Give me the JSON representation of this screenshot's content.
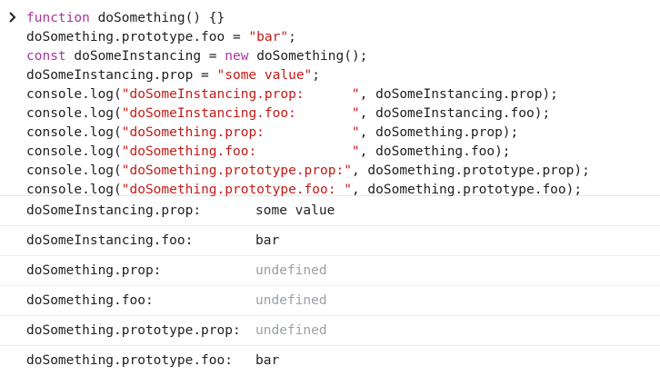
{
  "input": {
    "lines": [
      [
        {
          "t": "function",
          "c": "kw"
        },
        {
          "t": " doSomething() {}",
          "c": "fn"
        }
      ],
      [
        {
          "t": "doSomething.prototype.foo = ",
          "c": "fn"
        },
        {
          "t": "\"bar\"",
          "c": "str"
        },
        {
          "t": ";",
          "c": "punc"
        }
      ],
      [
        {
          "t": "const",
          "c": "kw"
        },
        {
          "t": " doSomeInstancing = ",
          "c": "fn"
        },
        {
          "t": "new",
          "c": "kw"
        },
        {
          "t": " doSomething();",
          "c": "fn"
        }
      ],
      [
        {
          "t": "doSomeInstancing.prop = ",
          "c": "fn"
        },
        {
          "t": "\"some value\"",
          "c": "str"
        },
        {
          "t": ";",
          "c": "punc"
        }
      ],
      [
        {
          "t": "console.log(",
          "c": "fn"
        },
        {
          "t": "\"doSomeInstancing.prop:      \"",
          "c": "str"
        },
        {
          "t": ", doSomeInstancing.prop);",
          "c": "fn"
        }
      ],
      [
        {
          "t": "console.log(",
          "c": "fn"
        },
        {
          "t": "\"doSomeInstancing.foo:       \"",
          "c": "str"
        },
        {
          "t": ", doSomeInstancing.foo);",
          "c": "fn"
        }
      ],
      [
        {
          "t": "console.log(",
          "c": "fn"
        },
        {
          "t": "\"doSomething.prop:           \"",
          "c": "str"
        },
        {
          "t": ", doSomething.prop);",
          "c": "fn"
        }
      ],
      [
        {
          "t": "console.log(",
          "c": "fn"
        },
        {
          "t": "\"doSomething.foo:            \"",
          "c": "str"
        },
        {
          "t": ", doSomething.foo);",
          "c": "fn"
        }
      ],
      [
        {
          "t": "console.log(",
          "c": "fn"
        },
        {
          "t": "\"doSomething.prototype.prop:\"",
          "c": "str"
        },
        {
          "t": ", doSomething.prototype.prop);",
          "c": "fn"
        }
      ],
      [
        {
          "t": "console.log(",
          "c": "fn"
        },
        {
          "t": "\"doSomething.prototype.foo: \"",
          "c": "str"
        },
        {
          "t": ", doSomething.prototype.foo);",
          "c": "fn"
        }
      ]
    ]
  },
  "outputs": [
    {
      "label": "doSomeInstancing.prop:",
      "value": "some value",
      "undefined": false
    },
    {
      "label": "doSomeInstancing.foo:",
      "value": "bar",
      "undefined": false
    },
    {
      "label": "doSomething.prop:",
      "value": "undefined",
      "undefined": true
    },
    {
      "label": "doSomething.foo:",
      "value": "undefined",
      "undefined": true
    },
    {
      "label": "doSomething.prototype.prop:",
      "value": "undefined",
      "undefined": true
    },
    {
      "label": "doSomething.prototype.foo:",
      "value": "bar",
      "undefined": false
    }
  ],
  "colors": {
    "keyword": "#a8359c",
    "string": "#c41a16",
    "text": "#202124",
    "undefined": "#9aa0a6"
  },
  "icons": {
    "prompt": "chevron-right-icon"
  }
}
